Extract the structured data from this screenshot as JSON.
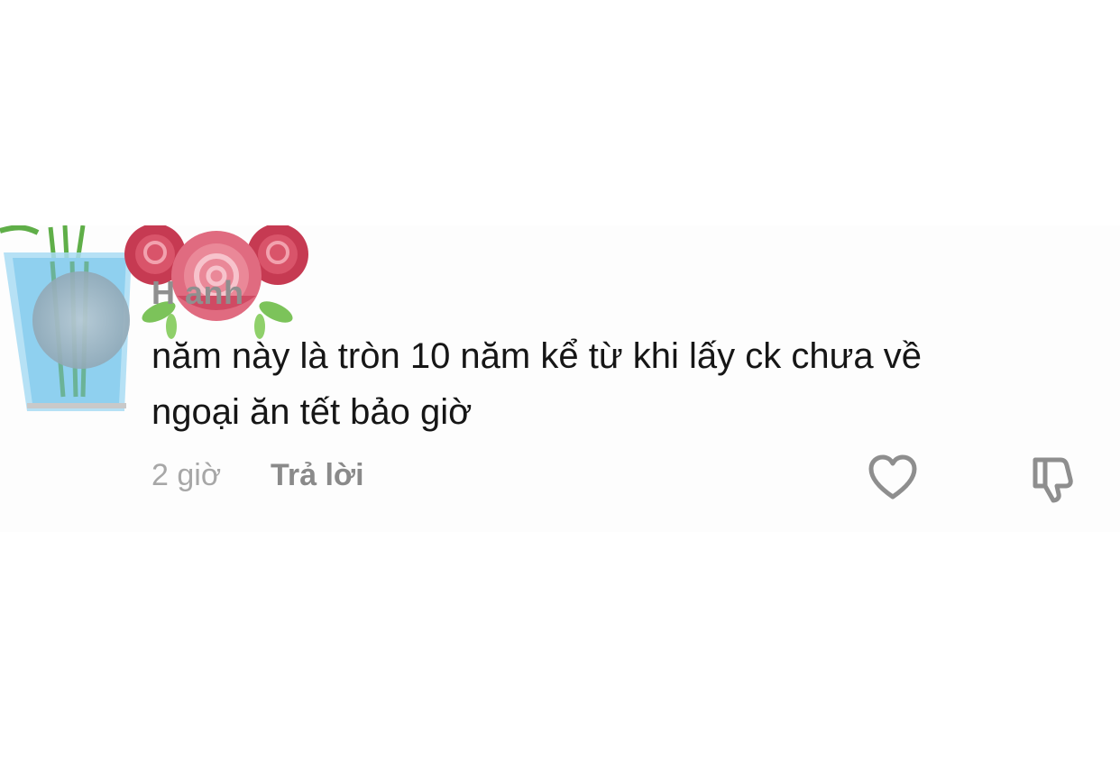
{
  "comment": {
    "username": "H      anh",
    "text_line1": "năm này là tròn 10 năm kể từ khi lấy ck chưa về",
    "text_line2": "ngoại ăn tết bảo giờ",
    "time": "2 giờ",
    "reply_label": "Trả lời"
  },
  "icons": {
    "like": "heart-outline-icon",
    "dislike": "thumbs-down-outline-icon"
  },
  "colors": {
    "text": "#161616",
    "muted": "#a7a7a7",
    "reply": "#8a8a8a",
    "icon": "#8e8e8e",
    "rose": "#d9546a",
    "leaf": "#7cc35a",
    "vase": "#8fd0ef"
  }
}
